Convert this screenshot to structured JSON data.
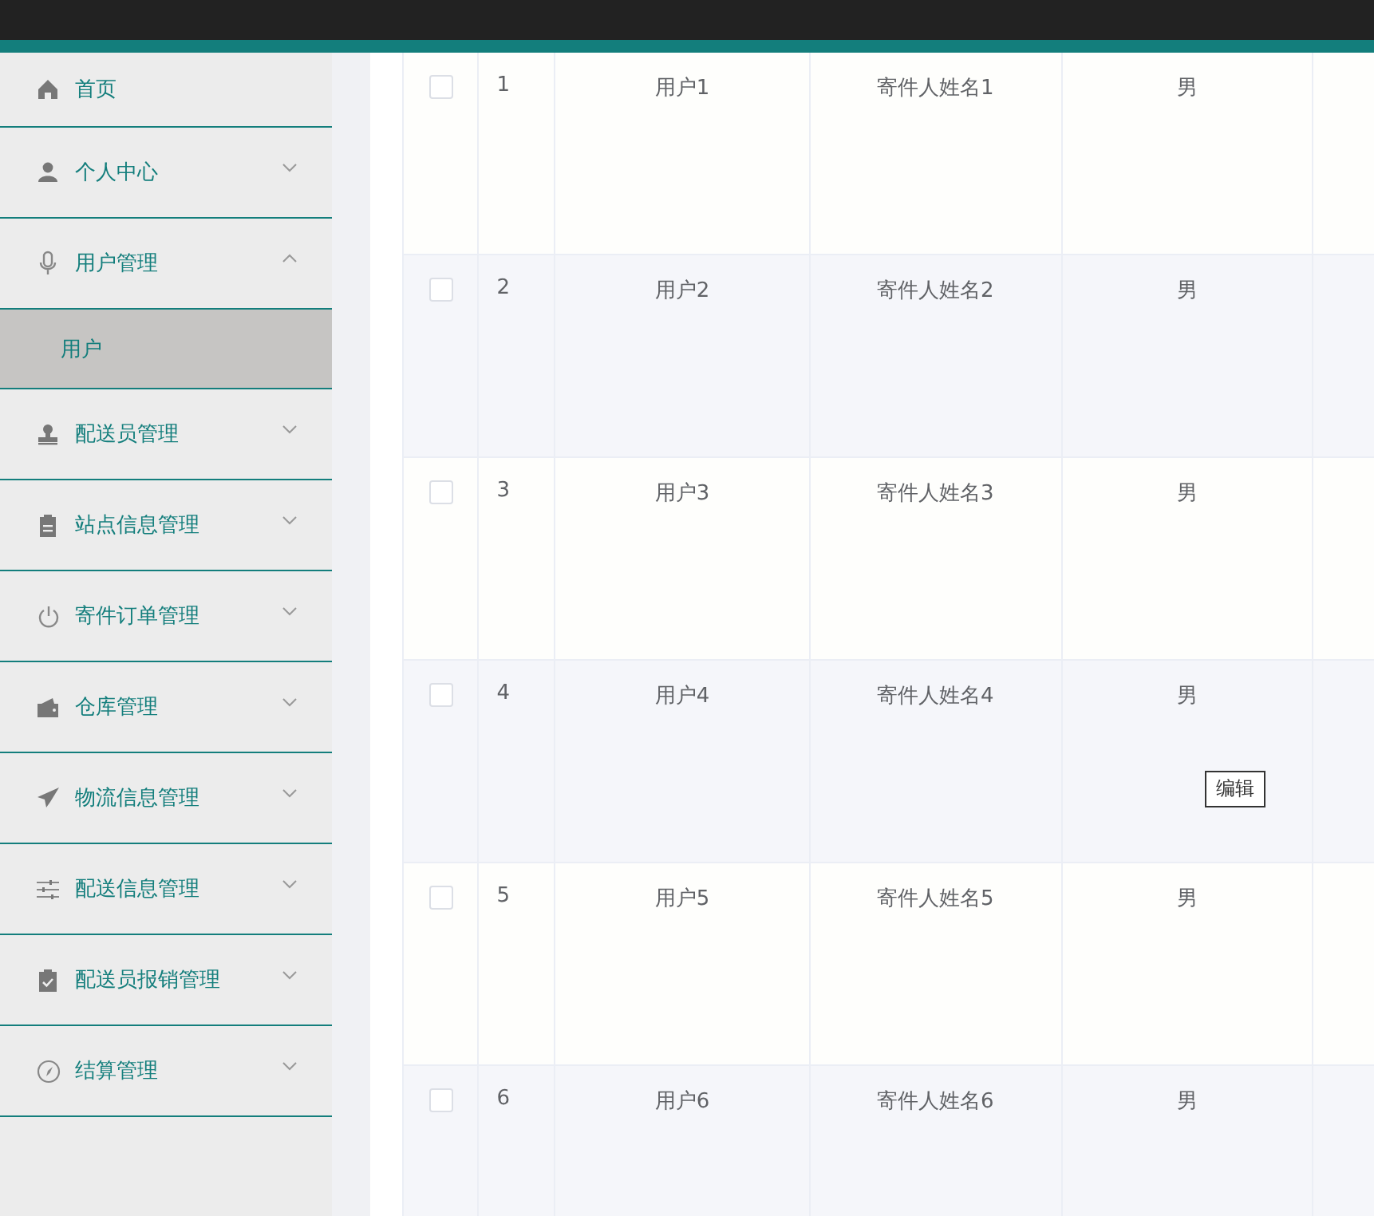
{
  "sidebar": {
    "items": [
      {
        "label": "首页"
      },
      {
        "label": "个人中心",
        "expanded": false
      },
      {
        "label": "用户管理",
        "expanded": true,
        "children": [
          {
            "label": "用户",
            "selected": true
          }
        ]
      },
      {
        "label": "配送员管理",
        "expanded": false
      },
      {
        "label": "站点信息管理",
        "expanded": false
      },
      {
        "label": "寄件订单管理",
        "expanded": false
      },
      {
        "label": "仓库管理",
        "expanded": false
      },
      {
        "label": "物流信息管理",
        "expanded": false
      },
      {
        "label": "配送信息管理",
        "expanded": false
      },
      {
        "label": "配送员报销管理",
        "expanded": false
      },
      {
        "label": "结算管理",
        "expanded": false
      }
    ]
  },
  "table": {
    "rows": [
      {
        "checked": false,
        "index": "1",
        "username": "用户1",
        "sender_name": "寄件人姓名1",
        "gender": "男"
      },
      {
        "checked": false,
        "index": "2",
        "username": "用户2",
        "sender_name": "寄件人姓名2",
        "gender": "男"
      },
      {
        "checked": false,
        "index": "3",
        "username": "用户3",
        "sender_name": "寄件人姓名3",
        "gender": "男"
      },
      {
        "checked": false,
        "index": "4",
        "username": "用户4",
        "sender_name": "寄件人姓名4",
        "gender": "男"
      },
      {
        "checked": false,
        "index": "5",
        "username": "用户5",
        "sender_name": "寄件人姓名5",
        "gender": "男"
      },
      {
        "checked": false,
        "index": "6",
        "username": "用户6",
        "sender_name": "寄件人姓名6",
        "gender": "男"
      }
    ]
  },
  "tooltip": {
    "text": "编辑"
  }
}
